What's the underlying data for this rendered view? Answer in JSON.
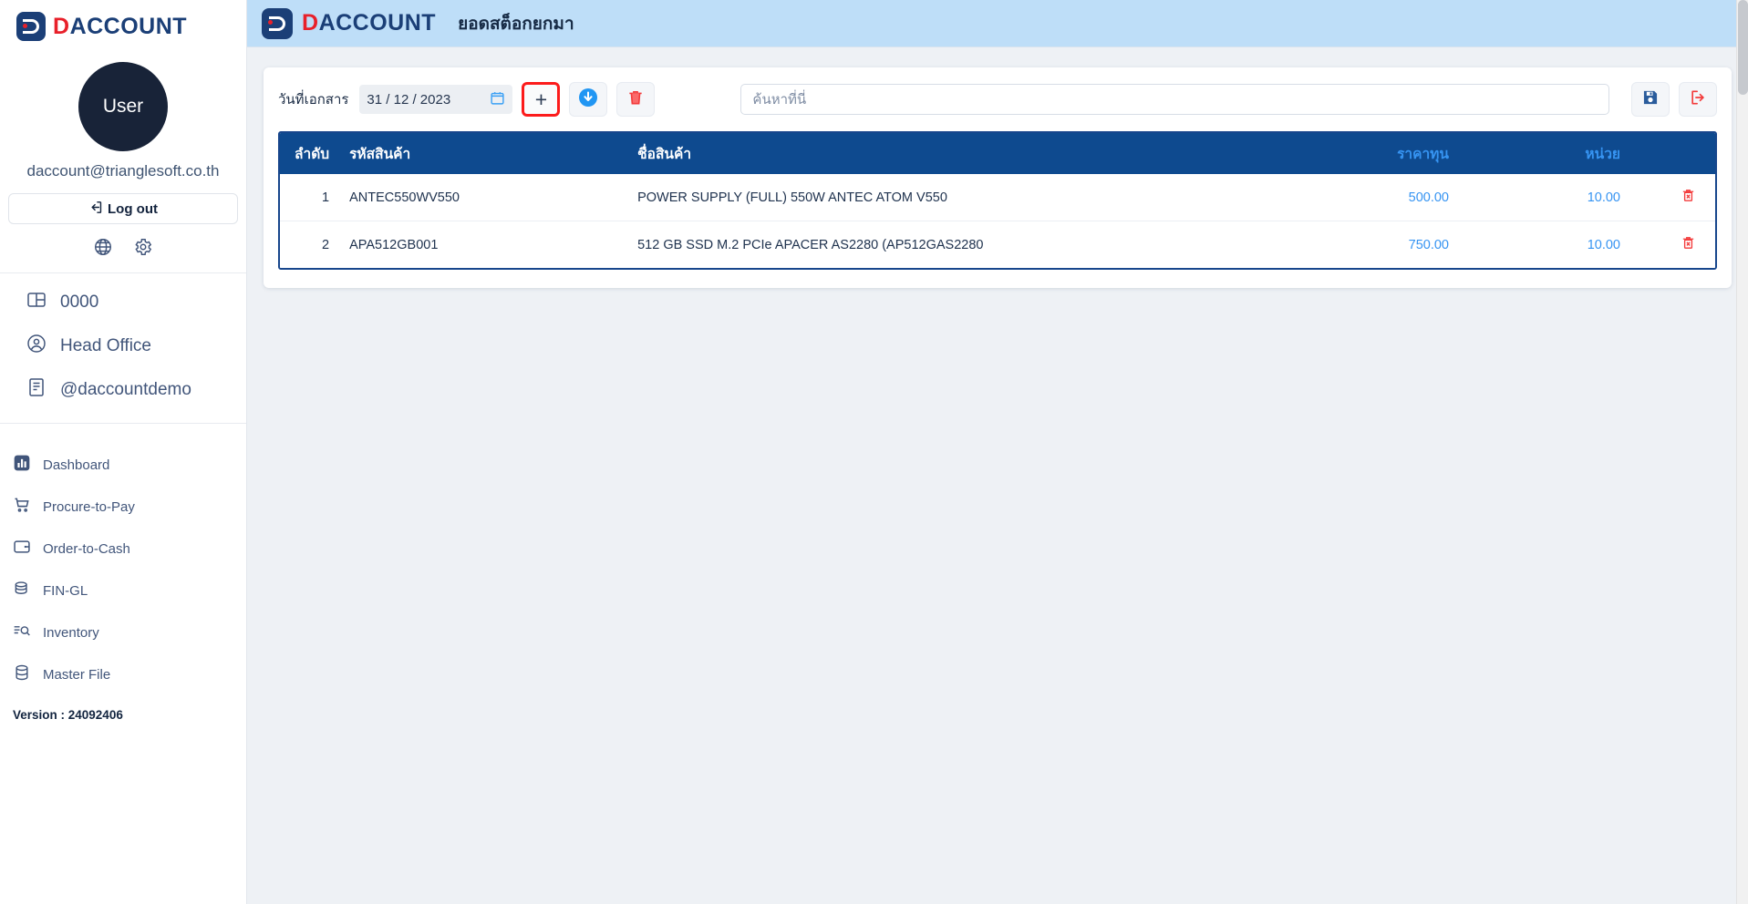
{
  "brand": {
    "word_red": "D",
    "word_blue": "ACCOUNT",
    "logo_name": "daccount-logo"
  },
  "sidebar": {
    "avatar_label": "User",
    "user_email": "daccount@trianglesoft.co.th",
    "logout_label": "Log out",
    "top_icons": [
      {
        "name": "globe-icon",
        "label": "globe"
      },
      {
        "name": "gear-icon",
        "label": "settings"
      }
    ],
    "org_items": [
      {
        "label": "0000",
        "icon": "branch-icon"
      },
      {
        "label": "Head Office",
        "icon": "user-circle-icon"
      },
      {
        "label": "@daccountdemo",
        "icon": "document-icon"
      }
    ],
    "nav_items": [
      {
        "label": "Dashboard",
        "icon": "dashboard-icon"
      },
      {
        "label": "Procure-to-Pay",
        "icon": "cart-icon"
      },
      {
        "label": "Order-to-Cash",
        "icon": "wallet-icon"
      },
      {
        "label": "FIN-GL",
        "icon": "coins-icon"
      },
      {
        "label": "Inventory",
        "icon": "inventory-search-icon"
      },
      {
        "label": "Master File",
        "icon": "database-icon"
      }
    ],
    "version": "Version : 24092406"
  },
  "header": {
    "page_title": "ยอดสต็อกยกมา"
  },
  "toolbar": {
    "date_label": "วันที่เอกสาร",
    "date_value": "31 / 12 / 2023",
    "add_label": "+",
    "buttons": [
      {
        "name": "add-row-button",
        "label": "+"
      },
      {
        "name": "import-download-button",
        "label": "download"
      },
      {
        "name": "delete-all-button",
        "label": "delete"
      },
      {
        "name": "save-button",
        "label": "save"
      },
      {
        "name": "exit-button",
        "label": "exit"
      }
    ],
    "search_placeholder": "ค้นหาที่นี่",
    "search_value": ""
  },
  "table": {
    "columns": {
      "seq": "ลำดับ",
      "code": "รหัสสินค้า",
      "name": "ชื่อสินค้า",
      "cost": "ราคาทุน",
      "unit": "หน่วย",
      "delete": ""
    },
    "rows": [
      {
        "seq": "1",
        "code": "ANTEC550WV550",
        "name": "POWER SUPPLY (FULL) 550W ANTEC ATOM V550",
        "cost": "500.00",
        "unit": "10.00"
      },
      {
        "seq": "2",
        "code": "APA512GB001",
        "name": "512 GB SSD M.2 PCIe APACER AS2280 (AP512GAS2280",
        "cost": "750.00",
        "unit": "10.00"
      }
    ]
  },
  "colors": {
    "topbar": "#bedef8",
    "table_header": "#0e4a8f",
    "table_border": "#17468c",
    "accent_blue": "#3694f2",
    "danger_red": "#fc1b1b",
    "page_bg": "#eef1f5",
    "nav_text": "#41557a"
  }
}
